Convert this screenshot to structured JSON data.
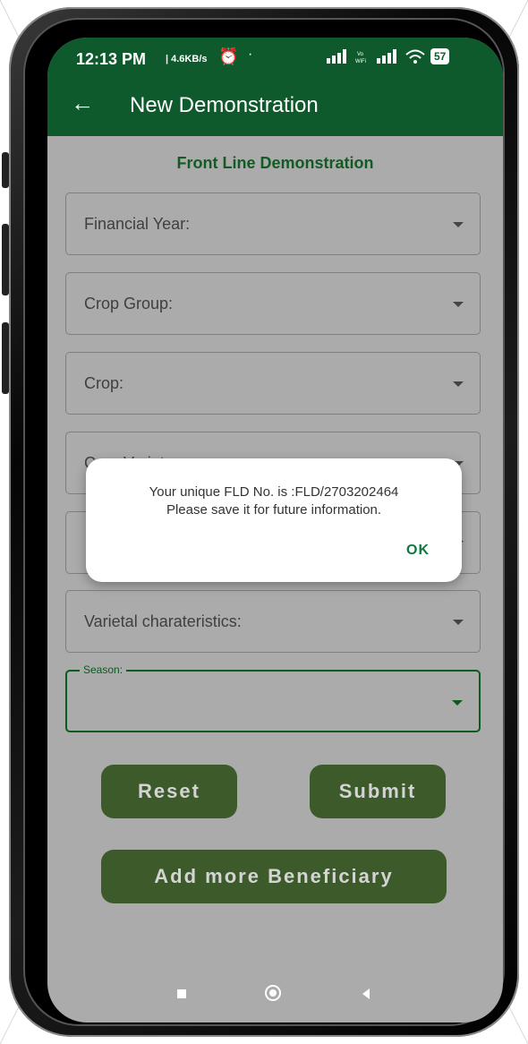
{
  "status_bar": {
    "time": "12:13 PM",
    "net_speed": "| 4.6KB/s",
    "battery": "57",
    "vo_wifi": "Vo WiFi"
  },
  "app_bar": {
    "back_icon": "arrow-left-icon",
    "title": "New Demonstration"
  },
  "form": {
    "section_title": "Front Line Demonstration",
    "fields": [
      {
        "label": "Financial Year:"
      },
      {
        "label": "Crop Group:"
      },
      {
        "label": "Crop:"
      },
      {
        "label": "Crop Variety:"
      },
      {
        "label": ""
      },
      {
        "label": "Varietal charateristics:"
      }
    ],
    "season_legend": "Season:"
  },
  "buttons": {
    "reset": "Reset",
    "submit": "Submit",
    "add_more": "Add more Beneficiary"
  },
  "dialog": {
    "line1": "Your unique FLD No. is :FLD/2703202464",
    "line2": "Please save it for future information.",
    "ok": "OK"
  },
  "colors": {
    "app_bar": "#0f5a2c",
    "button": "#3c5a2a",
    "scrim": "#ababab",
    "accent": "#0b7a3a"
  }
}
